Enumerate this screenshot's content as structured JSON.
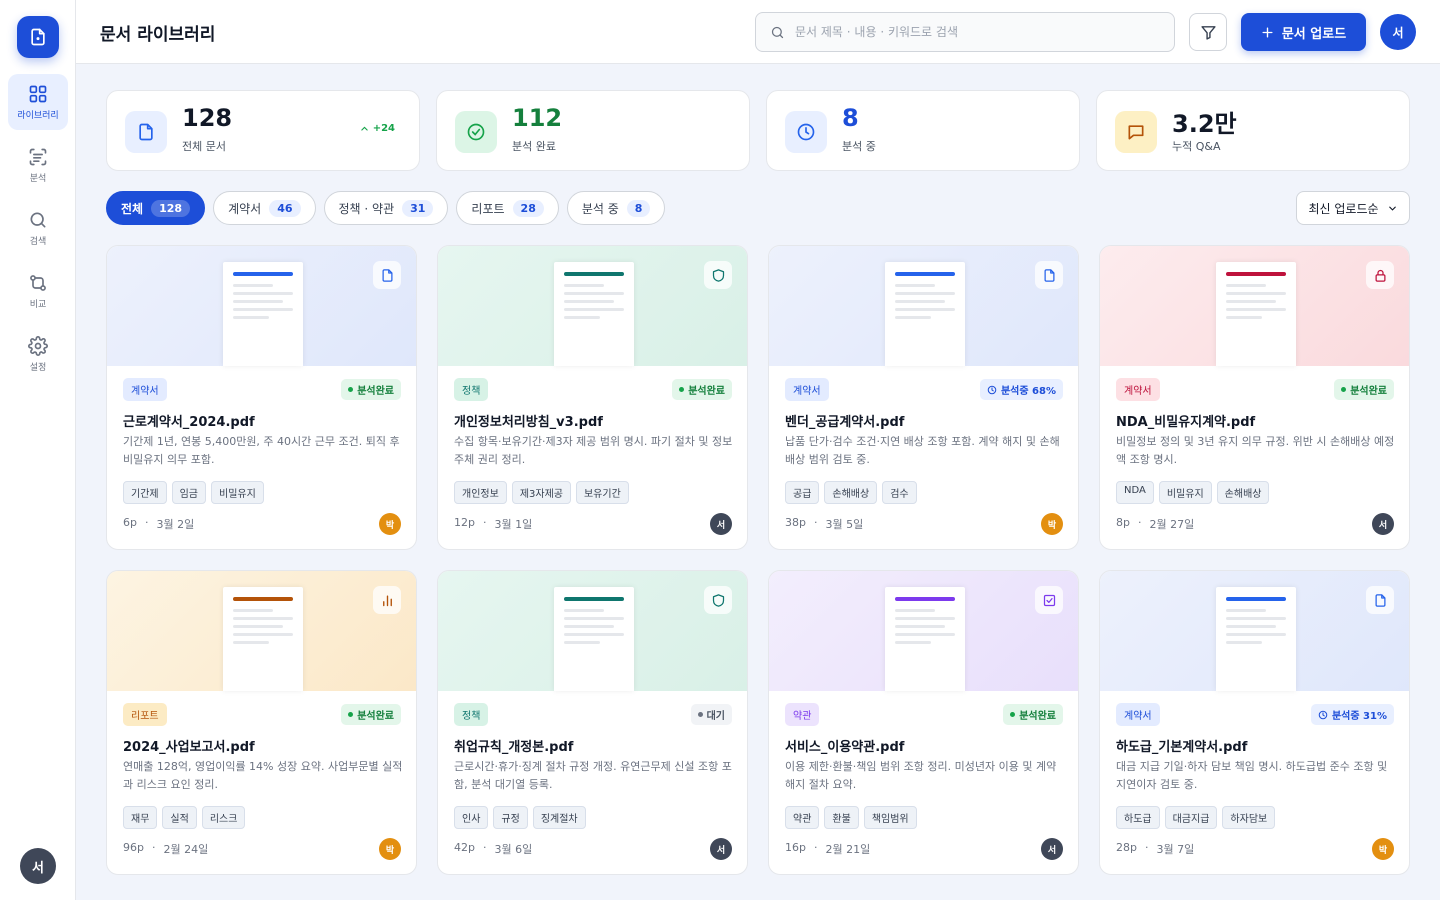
{
  "sidebar": {
    "items": [
      {
        "label": "라이브러리"
      },
      {
        "label": "분석"
      },
      {
        "label": "검색"
      },
      {
        "label": "비교"
      },
      {
        "label": "설정"
      }
    ],
    "avatar": "서"
  },
  "header": {
    "title": "문서 라이브러리",
    "search_placeholder": "문서 제목 · 내용 · 키워드로 검색",
    "upload_label": "문서 업로드",
    "avatar": "서"
  },
  "stats": [
    {
      "value": "128",
      "label": "전체 문서",
      "delta": "+24"
    },
    {
      "value": "112",
      "label": "분석 완료"
    },
    {
      "value": "8",
      "label": "분석 중"
    },
    {
      "value": "3.2만",
      "label": "누적 Q&A"
    }
  ],
  "filters": [
    {
      "label": "전체",
      "count": "128"
    },
    {
      "label": "계약서",
      "count": "46"
    },
    {
      "label": "정책 · 약관",
      "count": "31"
    },
    {
      "label": "리포트",
      "count": "28"
    },
    {
      "label": "분석 중",
      "count": "8"
    }
  ],
  "sort_label": "최신 업로드순",
  "colors": {
    "accent": "#1d4ed8",
    "success": "#16a34a",
    "contract": "#2563eb",
    "policy": "#0f766e",
    "nda": "#be123c",
    "report": "#b45309",
    "terms": "#7c3aed",
    "owner_park": "#e38f10",
    "owner_seo": "#3f4758"
  },
  "documents": [
    {
      "category": "계약서",
      "status": "분석완료",
      "name": "근로계약서_2024.pdf",
      "desc": "기간제 1년, 연봉 5,400만원, 주 40시간 근무 조건. 퇴직 후 비밀유지 의무 포함.",
      "tags": [
        "기간제",
        "임금",
        "비밀유지"
      ],
      "pages": "6p",
      "date": "3월 2일",
      "owner": "박",
      "icon": "file-icon"
    },
    {
      "category": "정책",
      "status": "분석완료",
      "name": "개인정보처리방침_v3.pdf",
      "desc": "수집 항목·보유기간·제3자 제공 범위 명시. 파기 절차 및 정보주체 권리 정리.",
      "tags": [
        "개인정보",
        "제3자제공",
        "보유기간"
      ],
      "pages": "12p",
      "date": "3월 1일",
      "owner": "서",
      "icon": "shield-icon"
    },
    {
      "category": "계약서",
      "status": "분석중 68%",
      "name": "벤더_공급계약서.pdf",
      "desc": "납품 단가·검수 조건·지연 배상 조항 포함. 계약 해지 및 손해배상 범위 검토 중.",
      "tags": [
        "공급",
        "손해배상",
        "검수"
      ],
      "pages": "38p",
      "date": "3월 5일",
      "owner": "박",
      "icon": "file-icon"
    },
    {
      "category": "계약서",
      "status": "분석완료",
      "name": "NDA_비밀유지계약.pdf",
      "desc": "비밀정보 정의 및 3년 유지 의무 규정. 위반 시 손해배상 예정액 조항 명시.",
      "tags": [
        "NDA",
        "비밀유지",
        "손해배상"
      ],
      "pages": "8p",
      "date": "2월 27일",
      "owner": "서",
      "icon": "lock-icon"
    },
    {
      "category": "리포트",
      "status": "분석완료",
      "name": "2024_사업보고서.pdf",
      "desc": "연매출 128억, 영업이익률 14% 성장 요약. 사업부문별 실적과 리스크 요인 정리.",
      "tags": [
        "재무",
        "실적",
        "리스크"
      ],
      "pages": "96p",
      "date": "2월 24일",
      "owner": "박",
      "icon": "bar-chart-icon"
    },
    {
      "category": "정책",
      "status": "대기",
      "name": "취업규칙_개정본.pdf",
      "desc": "근로시간·휴가·징계 절차 규정 개정. 유연근무제 신설 조항 포함, 분석 대기열 등록.",
      "tags": [
        "인사",
        "규정",
        "징계절차"
      ],
      "pages": "42p",
      "date": "3월 6일",
      "owner": "서",
      "icon": "shield-icon"
    },
    {
      "category": "약관",
      "status": "분석완료",
      "name": "서비스_이용약관.pdf",
      "desc": "이용 제한·환불·책임 범위 조항 정리. 미성년자 이용 및 계약 해지 절차 요약.",
      "tags": [
        "약관",
        "환불",
        "책임범위"
      ],
      "pages": "16p",
      "date": "2월 21일",
      "owner": "서",
      "icon": "check-square-icon"
    },
    {
      "category": "계약서",
      "status": "분석중 31%",
      "name": "하도급_기본계약서.pdf",
      "desc": "대금 지급 기일·하자 담보 책임 명시. 하도급법 준수 조항 및 지연이자 검토 중.",
      "tags": [
        "하도급",
        "대금지급",
        "하자담보"
      ],
      "pages": "28p",
      "date": "3월 7일",
      "owner": "박",
      "icon": "file-icon"
    }
  ]
}
